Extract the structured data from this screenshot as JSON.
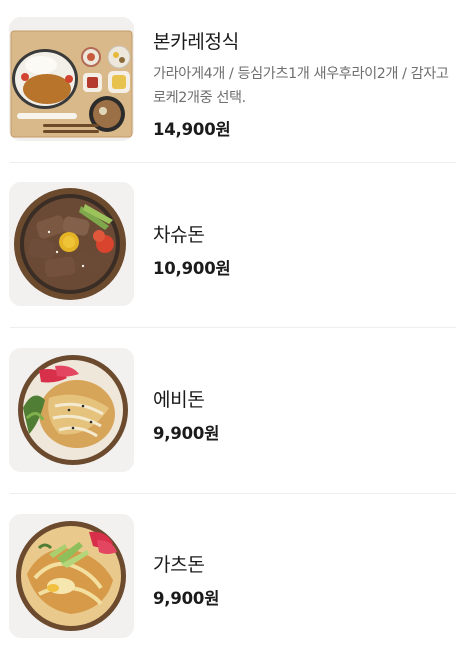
{
  "menu": {
    "items": [
      {
        "name": "본카레정식",
        "description": "가라아게4개 / 등심가츠1개 새우후라이2개 / 감자고로케2개중 선택.",
        "price": "14,900원",
        "image_icon": "curry-set-tray-photo"
      },
      {
        "name": "차슈돈",
        "price": "10,900원",
        "image_icon": "chashu-rice-bowl-photo"
      },
      {
        "name": "에비돈",
        "price": "9,900원",
        "image_icon": "ebi-rice-bowl-photo"
      },
      {
        "name": "가츠돈",
        "price": "9,900원",
        "image_icon": "katsu-rice-bowl-photo"
      }
    ]
  }
}
